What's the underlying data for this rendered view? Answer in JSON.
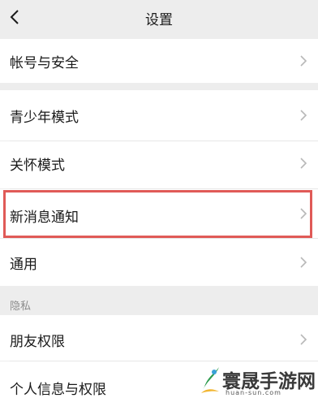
{
  "nav": {
    "title": "设置",
    "back_icon": "chevron-left-icon"
  },
  "rows": [
    {
      "label": "帐号与安全"
    },
    {
      "label": "青少年模式"
    },
    {
      "label": "关怀模式"
    },
    {
      "label": "新消息通知"
    },
    {
      "label": "通用"
    },
    {
      "label": "朋友权限"
    },
    {
      "label": "个人信息与权限"
    }
  ],
  "sections": {
    "privacy_label": "隐私"
  },
  "watermark": {
    "name": "寰晟手游网",
    "url": "huan-sun.com"
  },
  "colors": {
    "background": "#ededed",
    "row": "#ffffff",
    "highlight": "#e05a57"
  }
}
